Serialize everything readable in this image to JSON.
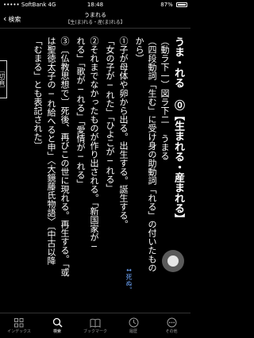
{
  "status_bar": {
    "carrier": "••••• SoftBank",
    "network": "4G",
    "time": "18:48",
    "battery": "87%"
  },
  "nav": {
    "back_label": "検索",
    "title": "うまれる",
    "subtitle": "【生(ま)れる・産(ま)れる】"
  },
  "entry": {
    "columns": [
      "うま・れる ⓪【生まれる・産まれる】",
      "（動ラ下一）図ラ下二 うまる",
      "（四段動詞「生む」に受け身の助動詞「れる」の付いたもの",
      "から）",
      "①子が母体や卵から出る。出生する。誕生する。",
      "「女の子が─れた」「ひよこが─れる」",
      "②それまでなかったものが作り出される。「新国家が─",
      "れる」「歌が─れる」「愛情が─れる」",
      "③〔仏教思想で〕死後、再びこの世に現れる。再生する。「或",
      "は聖徳太子の─れ給へると申」〈大鏡藤氏物語〉〔中古以降",
      "「むまる」とも表記された〕"
    ],
    "death_note": "↔死ぬ。",
    "side_tab": "〔切頁〕"
  },
  "tabs": [
    {
      "label": "インデックス",
      "icon": "grid-icon"
    },
    {
      "label": "検索",
      "icon": "search-icon"
    },
    {
      "label": "ブックマーク",
      "icon": "book-icon"
    },
    {
      "label": "履歴",
      "icon": "history-icon"
    },
    {
      "label": "その他",
      "icon": "more-icon"
    }
  ],
  "active_tab": "検索",
  "colors": {
    "background": "#000000",
    "text": "#ffffff",
    "accent_blue": "#6fa8ff",
    "float_button": "#5a5a5a"
  }
}
